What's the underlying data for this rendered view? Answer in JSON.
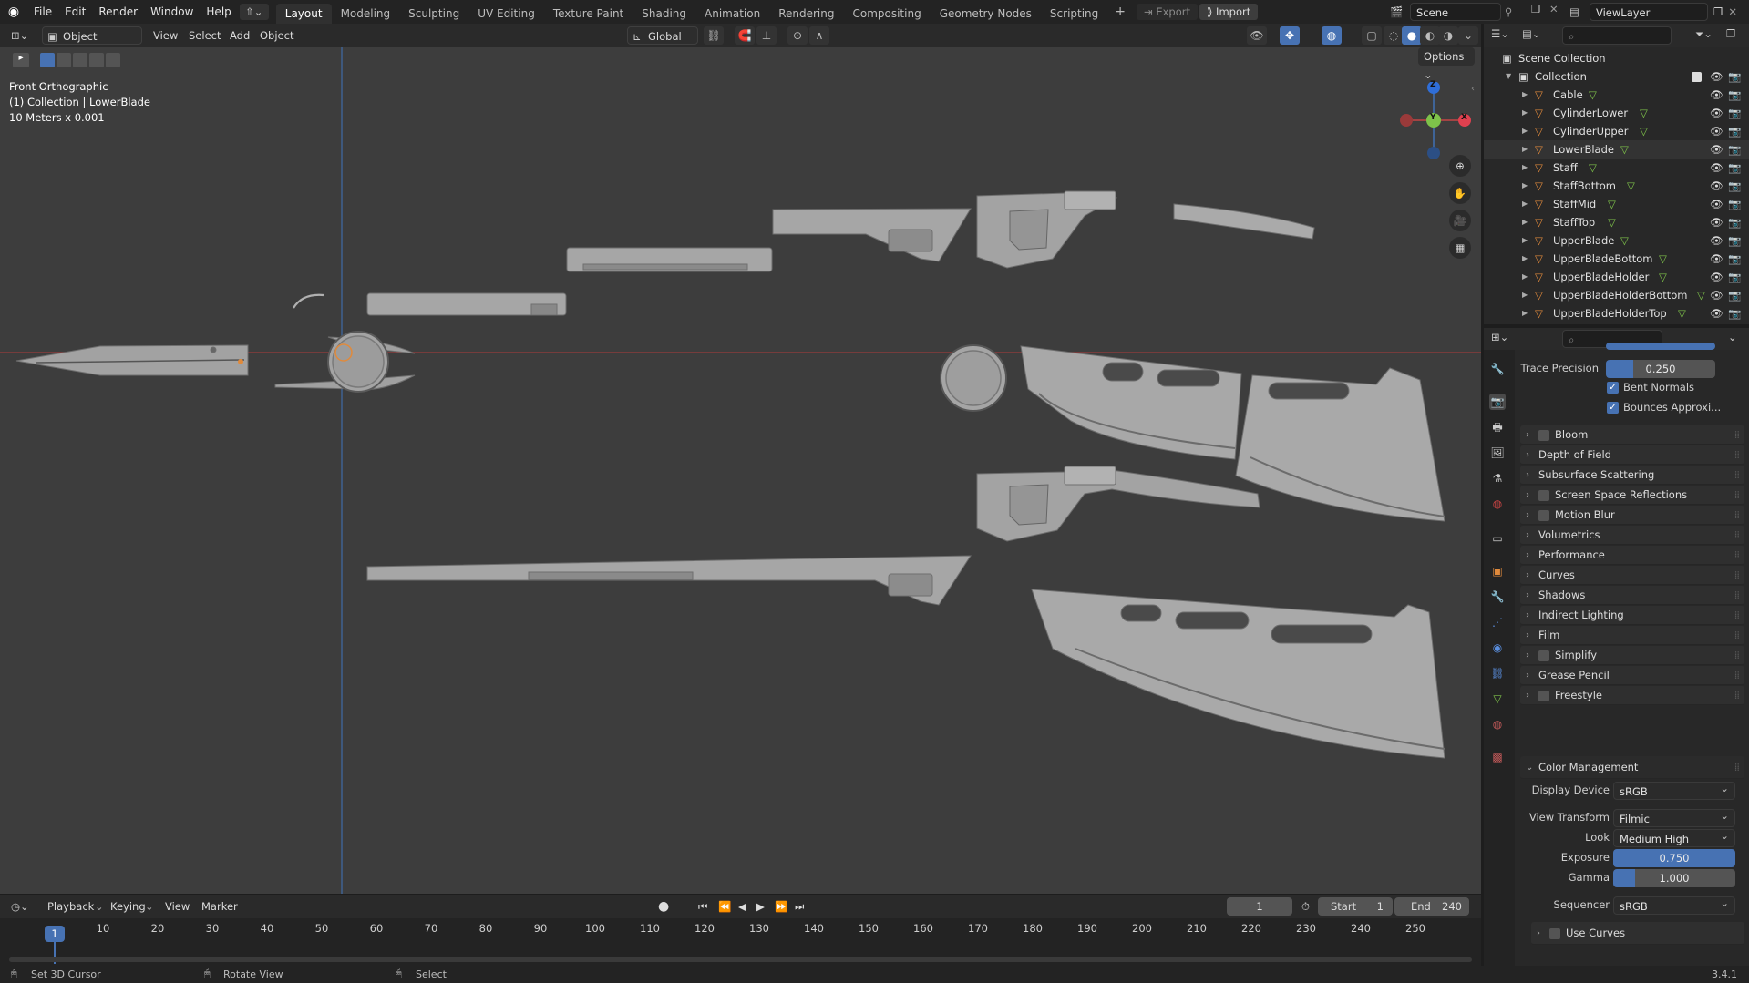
{
  "topbar": {
    "menus": [
      "File",
      "Edit",
      "Render",
      "Window",
      "Help"
    ],
    "workspaces": [
      "Layout",
      "Modeling",
      "Sculpting",
      "UV Editing",
      "Texture Paint",
      "Shading",
      "Animation",
      "Rendering",
      "Compositing",
      "Geometry Nodes",
      "Scripting"
    ],
    "active_workspace": "Layout",
    "export_label": "Export",
    "import_label": "Import",
    "scene_value": "Scene",
    "viewlayer_value": "ViewLayer"
  },
  "viewport_header": {
    "mode": "Object Mode",
    "menus": [
      "View",
      "Select",
      "Add",
      "Object"
    ],
    "orientation": "Global",
    "options_label": "Options"
  },
  "viewport_overlay": {
    "view_name": "Front Orthographic",
    "collection_info": "(1) Collection | LowerBlade",
    "scale_info": "10 Meters x 0.001"
  },
  "gizmo": {
    "z": "Z",
    "y": "Y",
    "x": "X"
  },
  "outliner": {
    "scene_collection": "Scene Collection",
    "collection": "Collection",
    "objects": [
      "Cable",
      "CylinderLower",
      "CylinderUpper",
      "LowerBlade",
      "Staff",
      "StaffBottom",
      "StaffMid",
      "StaffTop",
      "UpperBlade",
      "UpperBladeBottom",
      "UpperBladeHolder",
      "UpperBladeHolderBottom",
      "UpperBladeHolderTop"
    ]
  },
  "properties": {
    "trace_precision_label": "Trace Precision",
    "trace_precision_value": "0.250",
    "bent_normals_label": "Bent Normals",
    "bounces_label": "Bounces Approxi...",
    "sections": [
      {
        "label": "Bloom",
        "checkbox": true
      },
      {
        "label": "Depth of Field",
        "checkbox": false
      },
      {
        "label": "Subsurface Scattering",
        "checkbox": false
      },
      {
        "label": "Screen Space Reflections",
        "checkbox": true
      },
      {
        "label": "Motion Blur",
        "checkbox": true
      },
      {
        "label": "Volumetrics",
        "checkbox": false
      },
      {
        "label": "Performance",
        "checkbox": false
      },
      {
        "label": "Curves",
        "checkbox": false
      },
      {
        "label": "Shadows",
        "checkbox": false
      },
      {
        "label": "Indirect Lighting",
        "checkbox": false
      },
      {
        "label": "Film",
        "checkbox": false
      },
      {
        "label": "Simplify",
        "checkbox": true
      },
      {
        "label": "Grease Pencil",
        "checkbox": false
      },
      {
        "label": "Freestyle",
        "checkbox": true
      }
    ],
    "color_management": {
      "header": "Color Management",
      "display_device_label": "Display Device",
      "display_device_value": "sRGB",
      "view_transform_label": "View Transform",
      "view_transform_value": "Filmic",
      "look_label": "Look",
      "look_value": "Medium High Contrast",
      "exposure_label": "Exposure",
      "exposure_value": "0.750",
      "gamma_label": "Gamma",
      "gamma_value": "1.000",
      "sequencer_label": "Sequencer",
      "sequencer_value": "sRGB",
      "use_curves_label": "Use Curves"
    }
  },
  "timeline": {
    "menus": [
      "Playback",
      "Keying",
      "View",
      "Marker"
    ],
    "current_frame": "1",
    "start_label": "Start",
    "start_value": "1",
    "end_label": "End",
    "end_value": "240",
    "ticks": [
      "1",
      "10",
      "20",
      "30",
      "40",
      "50",
      "60",
      "70",
      "80",
      "90",
      "100",
      "110",
      "120",
      "130",
      "140",
      "150",
      "160",
      "170",
      "180",
      "190",
      "200",
      "210",
      "220",
      "230",
      "240",
      "250"
    ],
    "playhead_frame": "1"
  },
  "statusbar": {
    "hint1": "Set 3D Cursor",
    "hint2": "Rotate View",
    "hint3": "Select",
    "version": "3.4.1"
  },
  "colors": {
    "accent_blue": "#4772b3",
    "object_orange": "#e08a3c",
    "mesh_green": "#7ec24a",
    "viewport_bg": "#3d3d3d",
    "mesh_gray": "#9a9a9a"
  }
}
